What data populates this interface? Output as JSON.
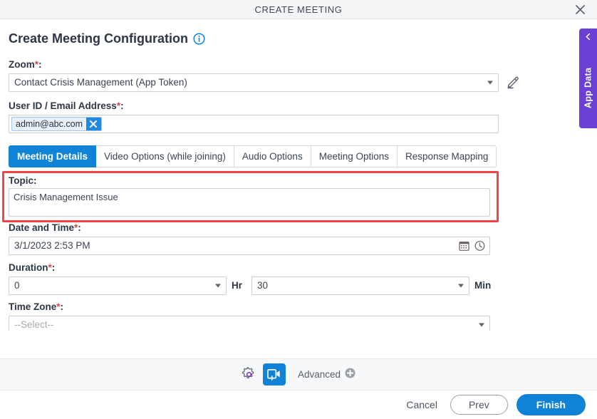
{
  "window": {
    "title": "CREATE MEETING",
    "close_icon": "close-icon"
  },
  "header": {
    "page_title": "Create Meeting Configuration",
    "info_icon": "info-icon"
  },
  "form": {
    "zoom": {
      "label": "Zoom",
      "required_mark": "*",
      "colon": ":",
      "value": "Contact Crisis Management (App Token)",
      "edit_icon": "pencil-icon",
      "caret_icon": "chevron-down-icon"
    },
    "user_id": {
      "label": "User ID / Email Address",
      "required_mark": "*",
      "colon": ":",
      "chip_value": "admin@abc.com",
      "chip_remove_icon": "close-icon"
    },
    "topic": {
      "label": "Topic",
      "colon": ":",
      "value": "Crisis Management Issue",
      "highlighted": true,
      "highlight_color": "#f5434a"
    },
    "date_time": {
      "label": "Date and Time",
      "required_mark": "*",
      "colon": ":",
      "value": "3/1/2023 2:53 PM",
      "calendar_icon": "calendar-icon",
      "clock_icon": "clock-icon"
    },
    "duration": {
      "label": "Duration",
      "required_mark": "*",
      "colon": ":",
      "hours_value": "0",
      "hours_unit": "Hr",
      "minutes_value": "30",
      "minutes_unit": "Min"
    },
    "time_zone": {
      "label": "Time Zone",
      "required_mark": "*",
      "colon": ":",
      "value": "--Select--"
    }
  },
  "tabs": [
    {
      "label": "Meeting Details",
      "active": true
    },
    {
      "label": "Video Options (while joining)",
      "active": false
    },
    {
      "label": "Audio Options",
      "active": false
    },
    {
      "label": "Meeting Options",
      "active": false
    },
    {
      "label": "Response Mapping",
      "active": false
    }
  ],
  "app_data_panel": {
    "label": "App Data",
    "chevron_icon": "chevron-left-icon",
    "color": "#6b3fd4"
  },
  "toolbar": {
    "gear_icon": "gear-icon",
    "video_icon": "video-add-icon",
    "advanced_label": "Advanced",
    "advanced_add_icon": "plus-circle-icon"
  },
  "footer": {
    "cancel_label": "Cancel",
    "prev_label": "Prev",
    "finish_label": "Finish"
  },
  "colors": {
    "accent_blue": "#1183d6",
    "purple": "#6b3fd4",
    "highlight_red": "#f5434a",
    "required_red": "#d6454a"
  }
}
